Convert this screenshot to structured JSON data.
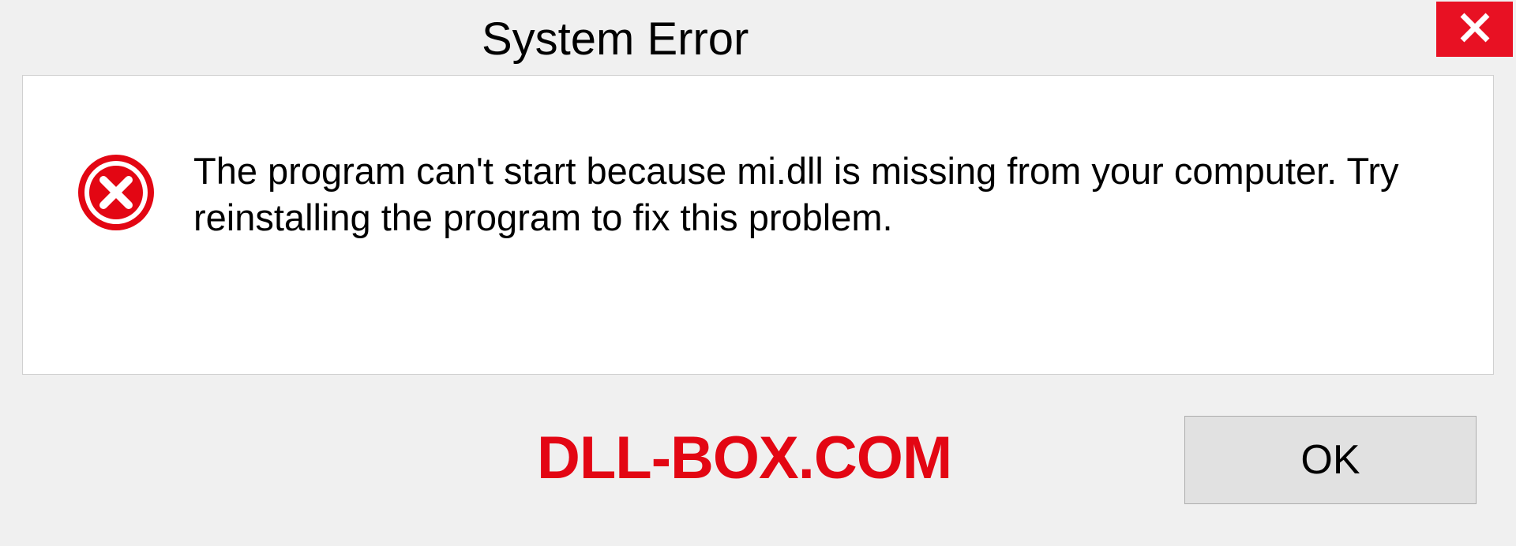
{
  "dialog": {
    "title": "System Error",
    "message": "The program can't start because mi.dll is missing from your computer. Try reinstalling the program to fix this problem.",
    "ok_label": "OK"
  },
  "watermark": "DLL-BOX.COM",
  "colors": {
    "close_bg": "#e81123",
    "error_icon": "#e30613",
    "watermark": "#e30613"
  }
}
